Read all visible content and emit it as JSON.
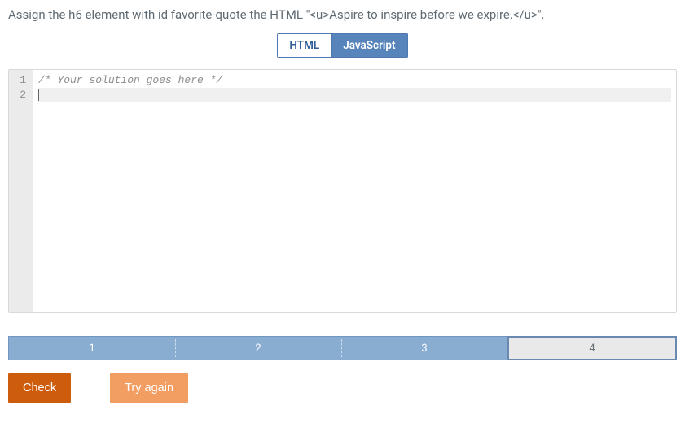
{
  "prompt": "Assign the h6 element with id favorite-quote the HTML \"<u>Aspire to inspire before we expire.</u>\".",
  "tabs": {
    "html": "HTML",
    "js": "JavaScript",
    "active": "js"
  },
  "editor": {
    "lines": [
      {
        "n": "1",
        "text": "/* Your solution goes here */",
        "cls": "comment"
      },
      {
        "n": "2",
        "text": "",
        "cls": "active"
      }
    ]
  },
  "steps": {
    "items": [
      {
        "label": "1",
        "state": "completed"
      },
      {
        "label": "2",
        "state": "completed"
      },
      {
        "label": "3",
        "state": "completed"
      },
      {
        "label": "4",
        "state": "current"
      }
    ]
  },
  "buttons": {
    "check": "Check",
    "retry": "Try again"
  }
}
